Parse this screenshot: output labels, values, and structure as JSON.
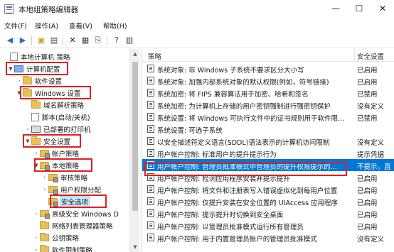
{
  "window": {
    "title": "本地组策略编辑器",
    "minimize": "—",
    "maximize": "☐",
    "close": "✕"
  },
  "menu": [
    "文件(F)",
    "操作(A)",
    "查看(V)",
    "帮助(H)"
  ],
  "toolbar": {
    "icons": [
      "back-icon",
      "forward-icon",
      "up-folder-icon",
      "show-tree-icon",
      "delete-icon",
      "properties-icon",
      "export-icon",
      "help-icon",
      "details-view-icon"
    ]
  },
  "tree": {
    "items": [
      {
        "label": "本地计算机 策略",
        "arrow": "",
        "icon": "doc"
      },
      {
        "label": "计算机配置",
        "arrow": "▼",
        "icon": "pc"
      },
      {
        "label": "软件设置",
        "arrow": "›",
        "icon": "folder"
      },
      {
        "label": "Windows 设置",
        "arrow": "▼",
        "icon": "folder"
      },
      {
        "label": "域名解析策略",
        "arrow": "",
        "icon": "folder"
      },
      {
        "label": "脚本(启动/关机)",
        "arrow": "",
        "icon": "doc"
      },
      {
        "label": "已部署的打印机",
        "arrow": "›",
        "icon": "print"
      },
      {
        "label": "安全设置",
        "arrow": "▼",
        "icon": "folder"
      },
      {
        "label": "帐户策略",
        "arrow": "›",
        "icon": "lock"
      },
      {
        "label": "本地策略",
        "arrow": "▼",
        "icon": "lock"
      },
      {
        "label": "审核策略",
        "arrow": "›",
        "icon": "lock"
      },
      {
        "label": "用户权限分配",
        "arrow": "›",
        "icon": "lock"
      },
      {
        "label": "安全选项",
        "arrow": "",
        "icon": "lock"
      },
      {
        "label": "高级安全 Windows D",
        "arrow": "›",
        "icon": "lock"
      },
      {
        "label": "网络列表管理器策略",
        "arrow": "",
        "icon": "folder"
      },
      {
        "label": "公钥策略",
        "arrow": "›",
        "icon": "folder"
      },
      {
        "label": "软件限制策略",
        "arrow": "›",
        "icon": "folder"
      }
    ]
  },
  "list": {
    "headers": {
      "policy": "策略",
      "setting": "安全设置"
    },
    "rows": [
      {
        "policy": "系统对象: 非 Windows 子系统不要求区分大小写",
        "setting": "已启用"
      },
      {
        "policy": "系统对象: 加强内部系统对象的默认权限(例如，符号链接)",
        "setting": "已启用"
      },
      {
        "policy": "系统加密: 将 FIPS 兼容算法用于加密、哈希和签名",
        "setting": "已禁用"
      },
      {
        "policy": "系统加密: 为计算机上存储的用户密钥强制进行强密钥保护",
        "setting": "没有定义"
      },
      {
        "policy": "系统设置: 将 Windows 可执行文件中的证书规则用于软件限...",
        "setting": "已禁用"
      },
      {
        "policy": "系统设置: 可选子系统",
        "setting": ""
      },
      {
        "policy": "以安全描述符定义语言(SDDL)语法表示的计算机访问限制",
        "setting": "没有定义"
      },
      {
        "policy": "用户帐户控制: 标准用户的提升提示行为",
        "setting": "提示凭据"
      },
      {
        "policy": "用户帐户控制: 管理员批准模式中管理员的提升权限提示的...",
        "setting": "不提示，直"
      },
      {
        "policy": "用户帐户控制: 检测应用程序安装并提示提升",
        "setting": "已启用"
      },
      {
        "policy": "用户帐户控制: 将文件和注册表写入错误虚拟化到每用户位置",
        "setting": "已启用"
      },
      {
        "policy": "用户帐户控制: 仅提升安装在安全位置的 UIAccess 应用程序",
        "setting": "已启用"
      },
      {
        "policy": "用户帐户控制: 提示提升时切换到安全桌面",
        "setting": "已启用"
      },
      {
        "policy": "用户帐户控制: 以管理员批准模式运行所有管理员",
        "setting": "已启用"
      },
      {
        "policy": "用户帐户控制: 用于内置管理员帐户的管理员批准模式",
        "setting": "没有定义"
      }
    ]
  },
  "colors": {
    "highlight_box": "#e51c1c",
    "selection": "#0078d7",
    "folder": "#e9c15a"
  }
}
